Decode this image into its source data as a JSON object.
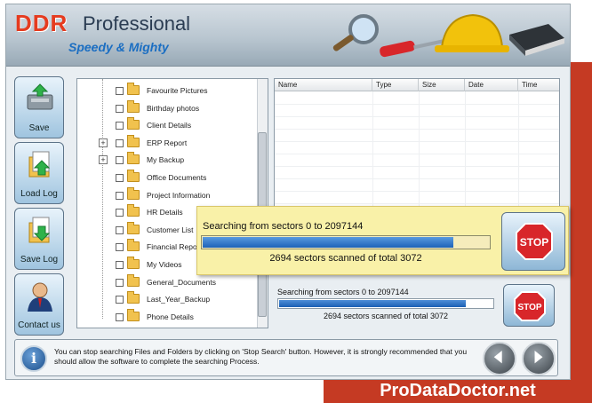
{
  "brand": {
    "logo_main": "DDR",
    "logo_sub": "Professional",
    "tagline": "Speedy & Mighty",
    "website": "ProDataDoctor.net"
  },
  "sidebar": {
    "buttons": [
      {
        "label": "Save",
        "icon": "save-icon"
      },
      {
        "label": "Load Log",
        "icon": "load-log-icon"
      },
      {
        "label": "Save Log",
        "icon": "save-log-icon"
      },
      {
        "label": "Contact us",
        "icon": "contact-icon"
      }
    ]
  },
  "tree": {
    "items": [
      {
        "label": "Favourite Pictures",
        "expandable": false
      },
      {
        "label": "Birthday photos",
        "expandable": false
      },
      {
        "label": "Client Details",
        "expandable": false
      },
      {
        "label": "ERP Report",
        "expandable": true
      },
      {
        "label": "My Backup",
        "expandable": true
      },
      {
        "label": "Office Documents",
        "expandable": false
      },
      {
        "label": "Project Information",
        "expandable": false
      },
      {
        "label": "HR Details",
        "expandable": false
      },
      {
        "label": "Customer List",
        "expandable": false
      },
      {
        "label": "Financial Report",
        "expandable": false
      },
      {
        "label": "My Videos",
        "expandable": false
      },
      {
        "label": "General_Documents",
        "expandable": false
      },
      {
        "label": "Last_Year_Backup",
        "expandable": false
      },
      {
        "label": "Phone Details",
        "expandable": false
      }
    ]
  },
  "file_list": {
    "columns": [
      "Name",
      "Type",
      "Size",
      "Date",
      "Time"
    ]
  },
  "progress": {
    "text": "Searching from sectors  0 to 2097144",
    "count_text": "2694  sectors scanned of total 3072",
    "scanned": 2694,
    "total": 3072
  },
  "overlay": {
    "text": "Searching from sectors  0 to 2097144",
    "count_text": "2694  sectors scanned of total 3072",
    "scanned": 2694,
    "total": 3072,
    "stop_label": "STOP"
  },
  "stop_button": {
    "label": "STOP"
  },
  "status": {
    "text": "You can stop searching Files and Folders by clicking on 'Stop Search' button. However, it is strongly recommended that you should allow the software to complete the searching Process."
  },
  "colors": {
    "accent_red": "#c53a23",
    "progress_blue": "#1b5fb4",
    "overlay_bg": "#f9f1a8"
  }
}
